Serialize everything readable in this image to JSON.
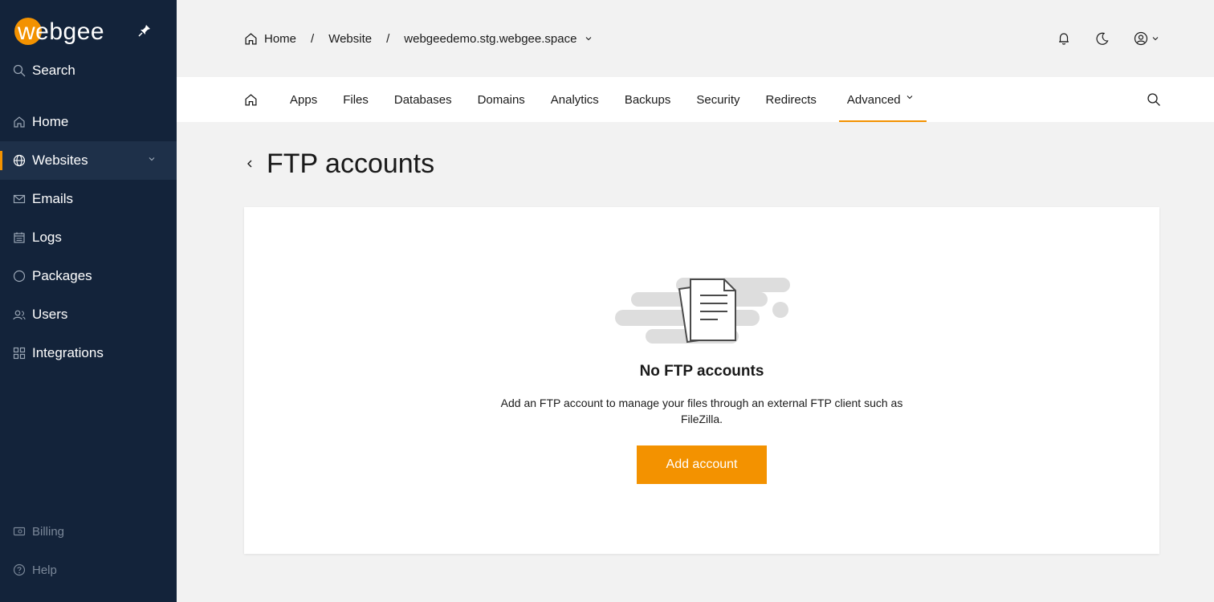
{
  "sidebar": {
    "logo_text": "webgee",
    "search_label": "Search",
    "items": [
      {
        "label": "Home",
        "icon": "home-icon"
      },
      {
        "label": "Websites",
        "icon": "globe-icon"
      },
      {
        "label": "Emails",
        "icon": "mail-icon"
      },
      {
        "label": "Logs",
        "icon": "calendar-icon"
      },
      {
        "label": "Packages",
        "icon": "circle-icon"
      },
      {
        "label": "Users",
        "icon": "users-icon"
      },
      {
        "label": "Integrations",
        "icon": "grid-icon"
      }
    ],
    "bottom_items": [
      {
        "label": "Billing",
        "icon": "billing-icon"
      },
      {
        "label": "Help",
        "icon": "help-icon"
      }
    ]
  },
  "breadcrumb": {
    "home": "Home",
    "website": "Website",
    "site": "webgeedemo.stg.webgee.space",
    "separator": "/"
  },
  "tabs": [
    "Apps",
    "Files",
    "Databases",
    "Domains",
    "Analytics",
    "Backups",
    "Security",
    "Redirects",
    "Advanced"
  ],
  "page": {
    "title": "FTP accounts"
  },
  "empty_state": {
    "title": "No FTP accounts",
    "description": "Add an FTP account to manage your files through an external FTP client such as FileZilla.",
    "button_label": "Add account"
  },
  "colors": {
    "accent": "#f39200",
    "sidebar_bg": "#13233a",
    "page_bg": "#f2f2f2"
  }
}
